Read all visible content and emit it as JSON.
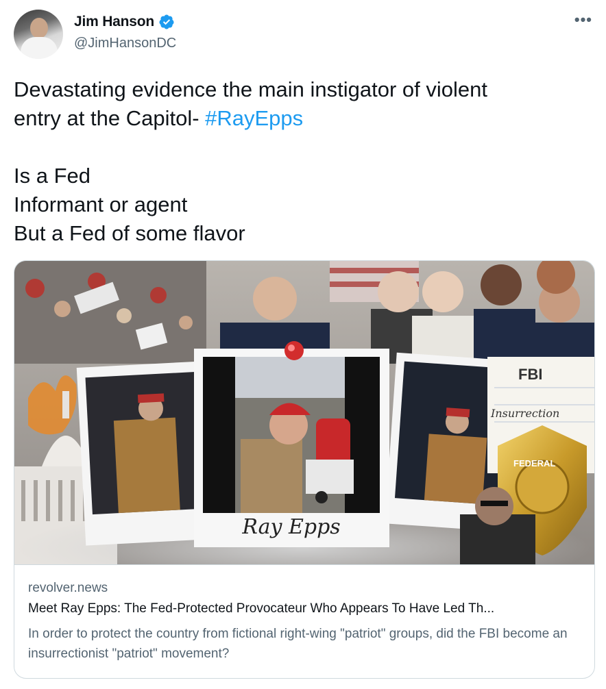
{
  "author": {
    "name": "Jim Hanson",
    "handle": "@JimHansonDC",
    "verified_icon": "verified-badge-icon"
  },
  "more_label": "•••",
  "tweet": {
    "text_part1": "Devastating evidence the main instigator of violent\nentry at the Capitol- ",
    "hashtag": "#RayEpps",
    "text_part2": "\n\nIs a Fed\nInformant or agent\nBut a Fed of some flavor"
  },
  "card": {
    "image_caption": "Ray Epps",
    "image_fbi_text": "FBI",
    "image_insurrection_text": "Insurrection",
    "image_badge_text": "FEDERAL",
    "domain": "revolver.news",
    "title": "Meet Ray Epps: The Fed-Protected Provocateur Who Appears To Have Led Th...",
    "description": "In order to protect the country from fictional right-wing \"patriot\" groups, did the FBI become an insurrectionist \"patriot\" movement?"
  },
  "colors": {
    "link": "#1d9bf0",
    "secondary_text": "#536471",
    "primary_text": "#0f1419",
    "border": "#cfd9de"
  }
}
